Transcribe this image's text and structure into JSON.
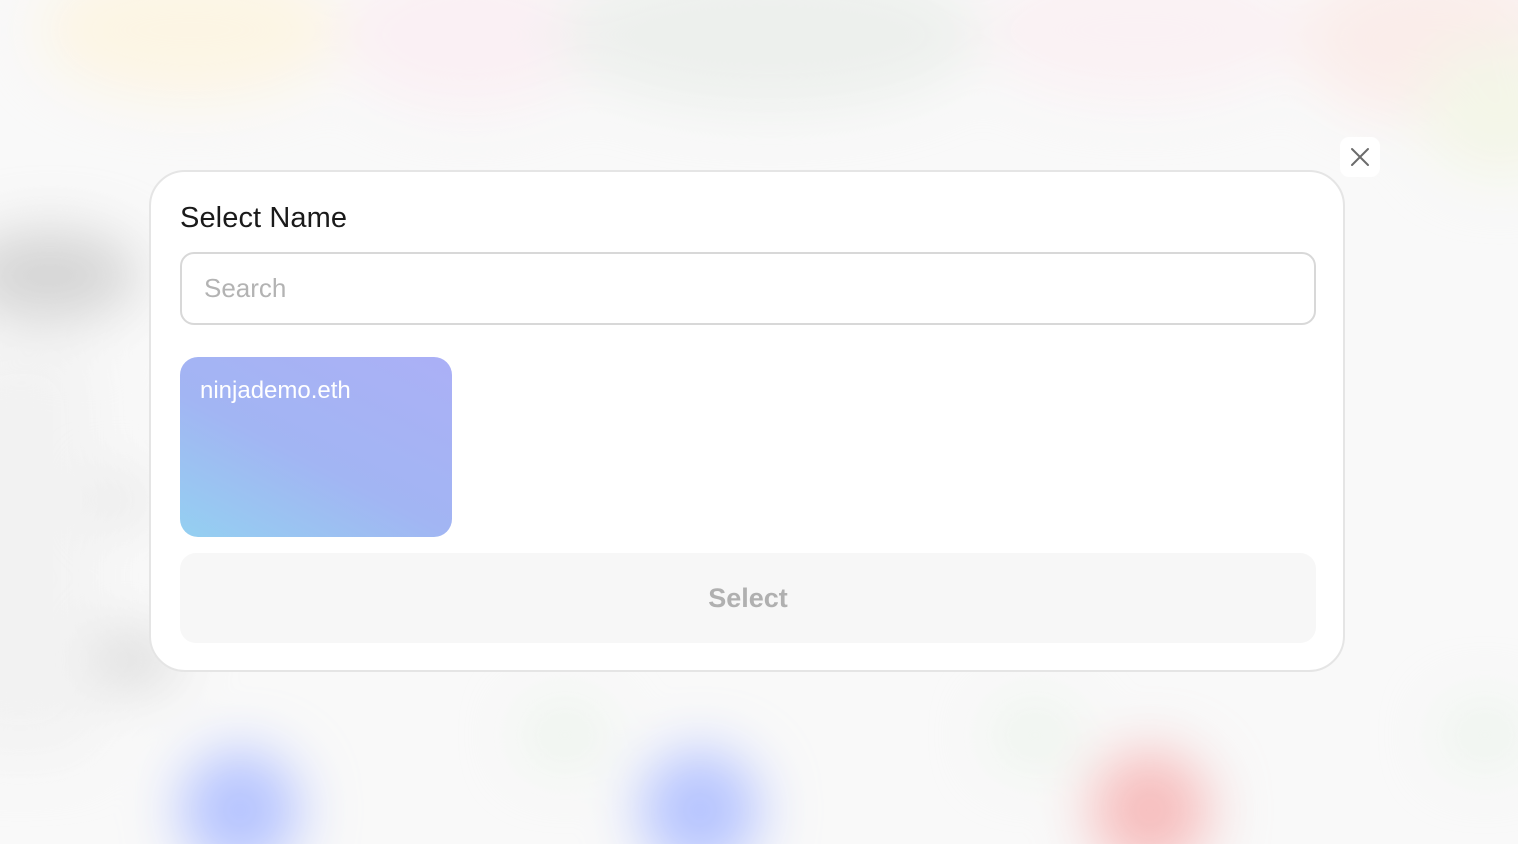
{
  "modal": {
    "title": "Select Name",
    "search_placeholder": "Search",
    "search_value": "",
    "names": [
      {
        "label": "ninjademo.eth"
      }
    ],
    "select_label": "Select",
    "close_icon": "close-icon"
  },
  "colors": {
    "card_gradient_start": "#94d0f1",
    "card_gradient_end": "#abb0f6",
    "select_button_bg": "#f7f7f7",
    "select_button_text": "#b0b0b0"
  }
}
